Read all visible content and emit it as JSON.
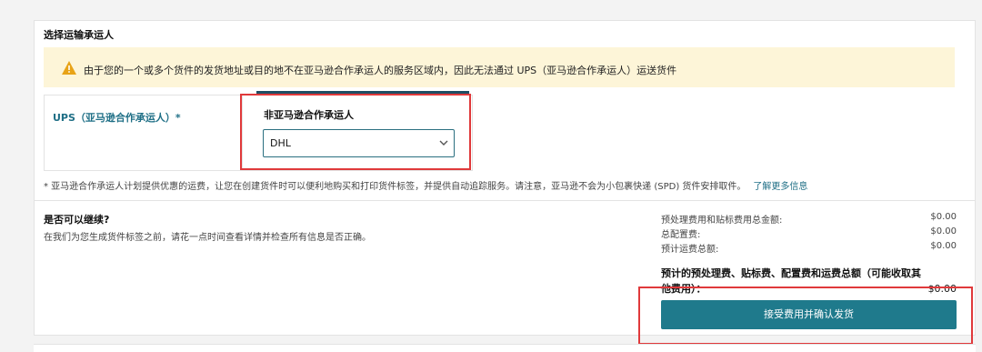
{
  "section_title": "选择运输承运人",
  "alert": {
    "icon": "warning-icon",
    "text": "由于您的一个或多个货件的发货地址或目的地不在亚马逊合作承运人的服务区域内，因此无法通过 UPS（亚马逊合作承运人）运送货件"
  },
  "carriers": {
    "partnered_label": "UPS（亚马逊合作承运人）*",
    "non_partnered_label": "非亚马逊合作承运人",
    "selected_carrier": "DHL"
  },
  "footnote": {
    "text": "* 亚马逊合作承运人计划提供优惠的运费，让您在创建货件时可以便利地购买和打印货件标签，并提供自动追踪服务。请注意，亚马逊不会为小包裹快递 (SPD) 货件安排取件。",
    "link": "了解更多信息"
  },
  "continue": {
    "title": "是否可以继续?",
    "description": "在我们为您生成货件标签之前，请花一点时间查看详情并检查所有信息是否正确。"
  },
  "fees": [
    {
      "label": "预处理费用和贴标费用总金额:",
      "amount": "$0.00"
    },
    {
      "label": "总配置费:",
      "amount": "$0.00"
    },
    {
      "label": "预计运费总额:",
      "amount": "$0.00"
    }
  ],
  "total": {
    "label": "预计的预处理费、贴标费、配置费和运费总额（可能收取其他费用）：",
    "amount": "$0.00"
  },
  "confirm_button": "接受费用并确认发货",
  "colors": {
    "accent": "#1f7a8c",
    "alert_bg": "#fdf5d8",
    "highlight": "#e0393b",
    "link": "#1f6f86"
  }
}
